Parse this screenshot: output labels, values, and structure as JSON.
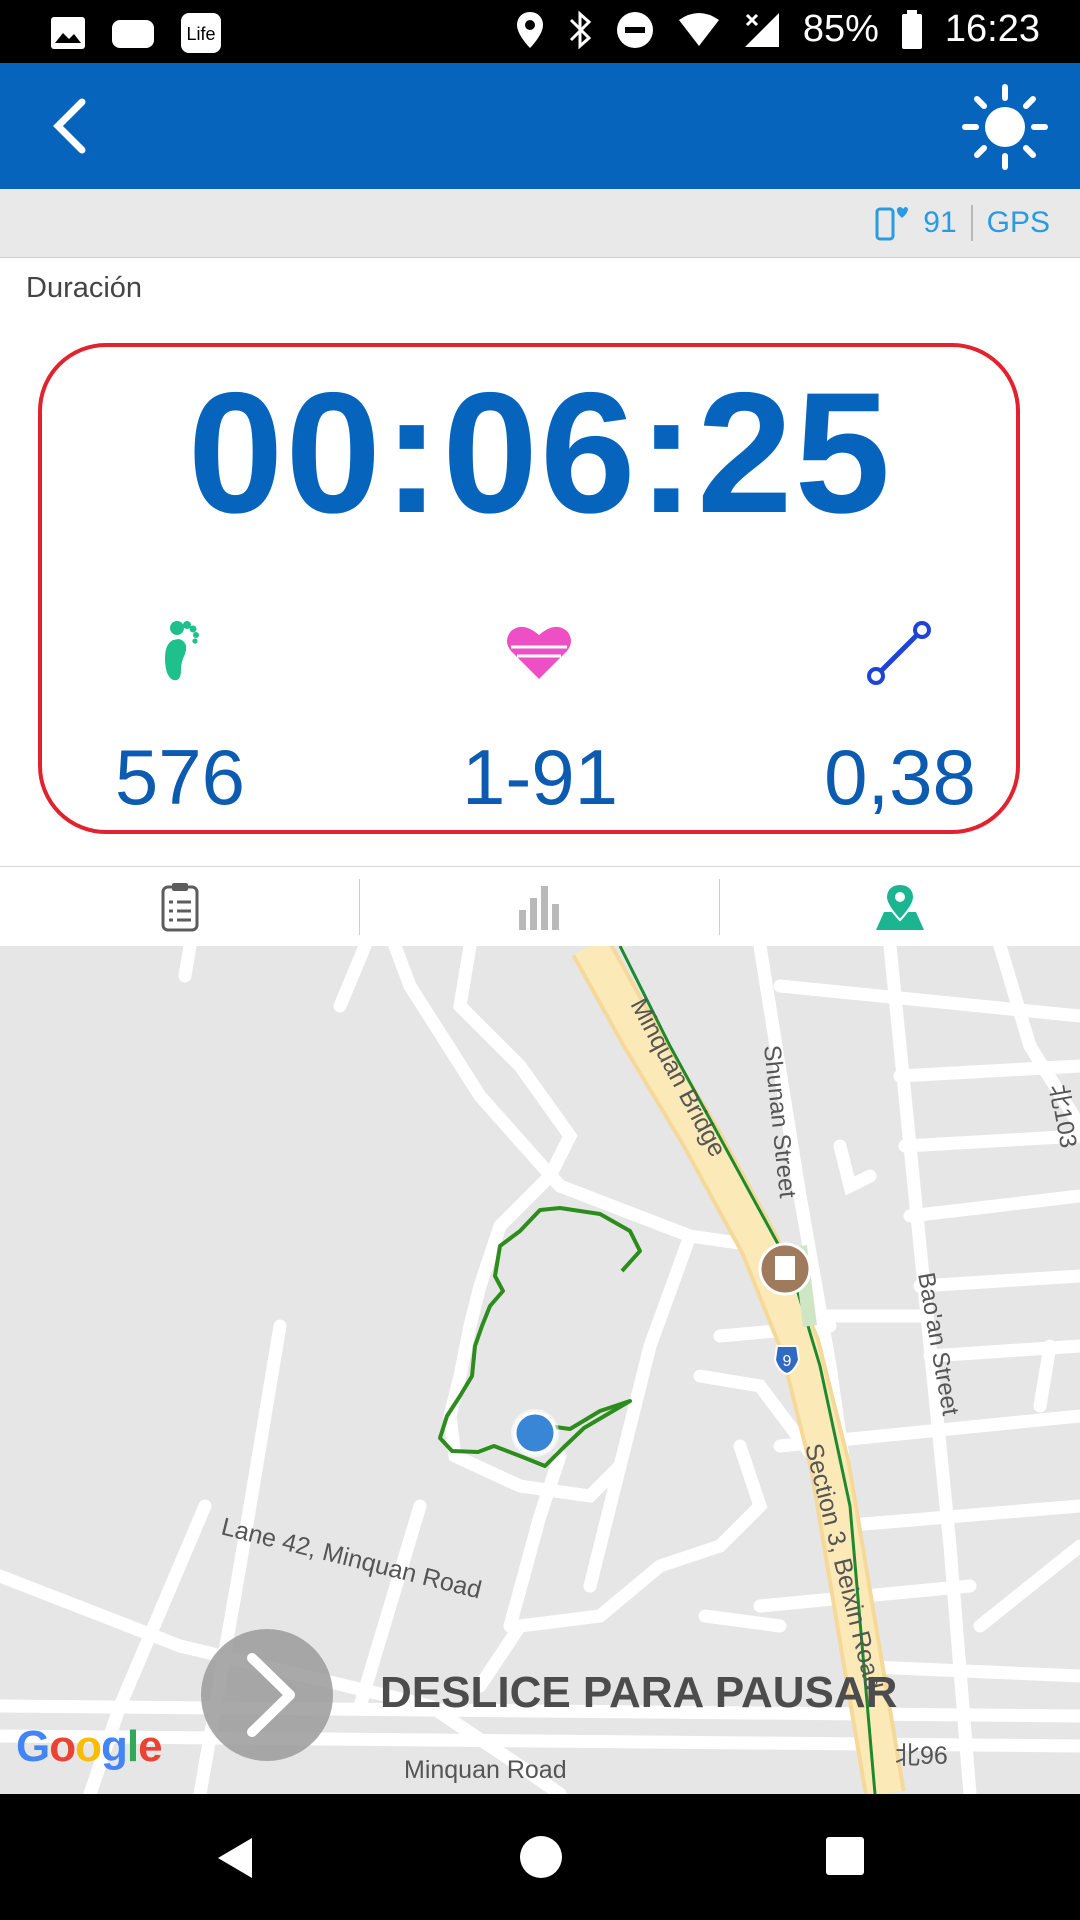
{
  "status_bar": {
    "battery": "85%",
    "time": "16:23",
    "icons": [
      "image-icon",
      "cloud-icon",
      "life-app-icon",
      "location-icon",
      "bluetooth-icon",
      "do-not-disturb-icon",
      "wifi-icon",
      "signal-icon",
      "battery-icon"
    ]
  },
  "app_bar": {
    "back_icon": "chevron-left-icon",
    "brightness_icon": "sun-icon",
    "color": "#0764bd"
  },
  "connection": {
    "heart_rate": "91",
    "gps_label": "GPS",
    "color": "#2a9be0"
  },
  "duration": {
    "label": "Duración",
    "value": "00:06:25"
  },
  "stats": {
    "steps": {
      "icon": "footprint-icon",
      "value": "576",
      "color": "#1fc08b"
    },
    "heart": {
      "icon": "heart-icon",
      "value": "1-91",
      "color": "#ee4fc4"
    },
    "distance": {
      "icon": "route-icon",
      "value": "0,38",
      "color": "#1e44d6"
    }
  },
  "tabs": [
    {
      "icon": "clipboard-icon",
      "active": false
    },
    {
      "icon": "bar-chart-icon",
      "active": false
    },
    {
      "icon": "map-pin-icon",
      "active": true,
      "color": "#1cb592"
    }
  ],
  "map": {
    "labels": {
      "minquan_bridge": "Minquan Bridge",
      "shunan_street": "Shunan Street",
      "north_103": "北103",
      "baoan_street": "Bao'an Street",
      "lane_42": "Lane 42, Minquan Road",
      "section_3": "Section 3, Beixin Road",
      "minquan_road": "Minquan Road",
      "north_96": "北96",
      "highway_marker": "9"
    },
    "attribution": "Google",
    "path_color": "#2c8c1c"
  },
  "slide_to_pause": {
    "label": "DESLICE PARA PAUSAR",
    "icon": "chevron-right-icon"
  },
  "nav_bar": {
    "icons": [
      "back-triangle-icon",
      "home-circle-icon",
      "recents-square-icon"
    ]
  }
}
